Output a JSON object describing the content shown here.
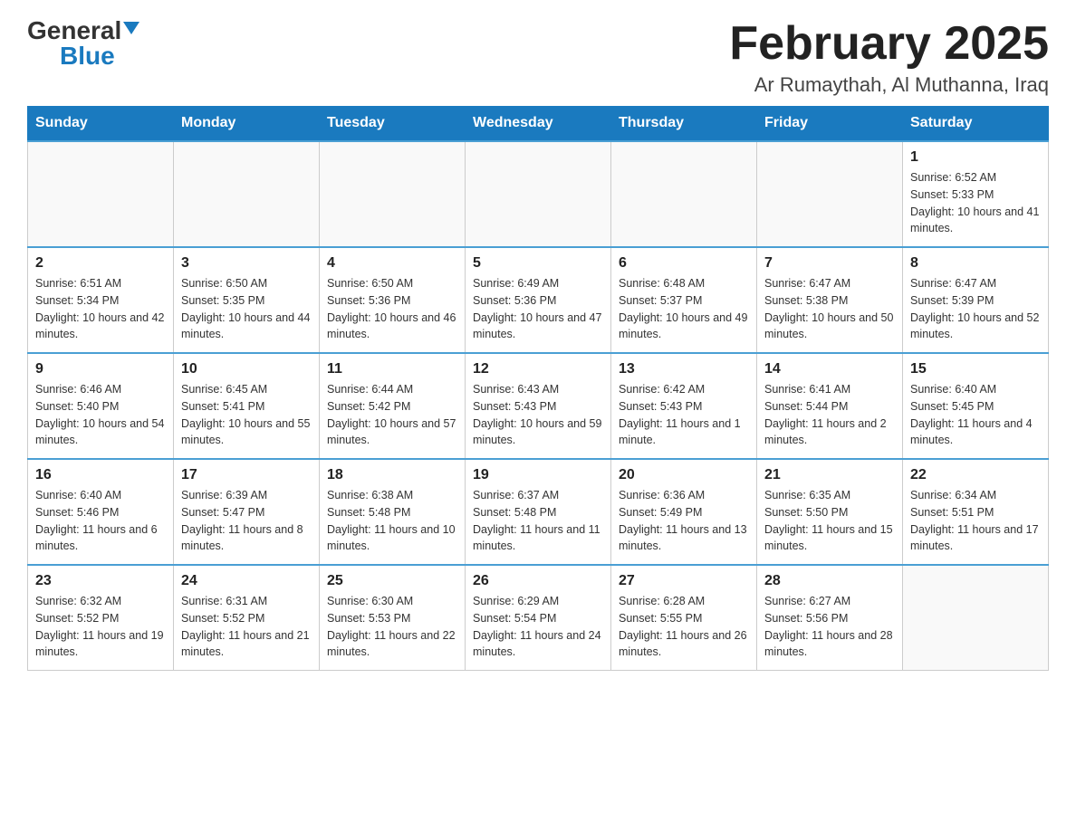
{
  "logo": {
    "general": "General",
    "blue": "Blue",
    "triangle": "▼"
  },
  "title": "February 2025",
  "location": "Ar Rumaythah, Al Muthanna, Iraq",
  "days_of_week": [
    "Sunday",
    "Monday",
    "Tuesday",
    "Wednesday",
    "Thursday",
    "Friday",
    "Saturday"
  ],
  "weeks": [
    [
      {
        "day": "",
        "info": ""
      },
      {
        "day": "",
        "info": ""
      },
      {
        "day": "",
        "info": ""
      },
      {
        "day": "",
        "info": ""
      },
      {
        "day": "",
        "info": ""
      },
      {
        "day": "",
        "info": ""
      },
      {
        "day": "1",
        "info": "Sunrise: 6:52 AM\nSunset: 5:33 PM\nDaylight: 10 hours and 41 minutes."
      }
    ],
    [
      {
        "day": "2",
        "info": "Sunrise: 6:51 AM\nSunset: 5:34 PM\nDaylight: 10 hours and 42 minutes."
      },
      {
        "day": "3",
        "info": "Sunrise: 6:50 AM\nSunset: 5:35 PM\nDaylight: 10 hours and 44 minutes."
      },
      {
        "day": "4",
        "info": "Sunrise: 6:50 AM\nSunset: 5:36 PM\nDaylight: 10 hours and 46 minutes."
      },
      {
        "day": "5",
        "info": "Sunrise: 6:49 AM\nSunset: 5:36 PM\nDaylight: 10 hours and 47 minutes."
      },
      {
        "day": "6",
        "info": "Sunrise: 6:48 AM\nSunset: 5:37 PM\nDaylight: 10 hours and 49 minutes."
      },
      {
        "day": "7",
        "info": "Sunrise: 6:47 AM\nSunset: 5:38 PM\nDaylight: 10 hours and 50 minutes."
      },
      {
        "day": "8",
        "info": "Sunrise: 6:47 AM\nSunset: 5:39 PM\nDaylight: 10 hours and 52 minutes."
      }
    ],
    [
      {
        "day": "9",
        "info": "Sunrise: 6:46 AM\nSunset: 5:40 PM\nDaylight: 10 hours and 54 minutes."
      },
      {
        "day": "10",
        "info": "Sunrise: 6:45 AM\nSunset: 5:41 PM\nDaylight: 10 hours and 55 minutes."
      },
      {
        "day": "11",
        "info": "Sunrise: 6:44 AM\nSunset: 5:42 PM\nDaylight: 10 hours and 57 minutes."
      },
      {
        "day": "12",
        "info": "Sunrise: 6:43 AM\nSunset: 5:43 PM\nDaylight: 10 hours and 59 minutes."
      },
      {
        "day": "13",
        "info": "Sunrise: 6:42 AM\nSunset: 5:43 PM\nDaylight: 11 hours and 1 minute."
      },
      {
        "day": "14",
        "info": "Sunrise: 6:41 AM\nSunset: 5:44 PM\nDaylight: 11 hours and 2 minutes."
      },
      {
        "day": "15",
        "info": "Sunrise: 6:40 AM\nSunset: 5:45 PM\nDaylight: 11 hours and 4 minutes."
      }
    ],
    [
      {
        "day": "16",
        "info": "Sunrise: 6:40 AM\nSunset: 5:46 PM\nDaylight: 11 hours and 6 minutes."
      },
      {
        "day": "17",
        "info": "Sunrise: 6:39 AM\nSunset: 5:47 PM\nDaylight: 11 hours and 8 minutes."
      },
      {
        "day": "18",
        "info": "Sunrise: 6:38 AM\nSunset: 5:48 PM\nDaylight: 11 hours and 10 minutes."
      },
      {
        "day": "19",
        "info": "Sunrise: 6:37 AM\nSunset: 5:48 PM\nDaylight: 11 hours and 11 minutes."
      },
      {
        "day": "20",
        "info": "Sunrise: 6:36 AM\nSunset: 5:49 PM\nDaylight: 11 hours and 13 minutes."
      },
      {
        "day": "21",
        "info": "Sunrise: 6:35 AM\nSunset: 5:50 PM\nDaylight: 11 hours and 15 minutes."
      },
      {
        "day": "22",
        "info": "Sunrise: 6:34 AM\nSunset: 5:51 PM\nDaylight: 11 hours and 17 minutes."
      }
    ],
    [
      {
        "day": "23",
        "info": "Sunrise: 6:32 AM\nSunset: 5:52 PM\nDaylight: 11 hours and 19 minutes."
      },
      {
        "day": "24",
        "info": "Sunrise: 6:31 AM\nSunset: 5:52 PM\nDaylight: 11 hours and 21 minutes."
      },
      {
        "day": "25",
        "info": "Sunrise: 6:30 AM\nSunset: 5:53 PM\nDaylight: 11 hours and 22 minutes."
      },
      {
        "day": "26",
        "info": "Sunrise: 6:29 AM\nSunset: 5:54 PM\nDaylight: 11 hours and 24 minutes."
      },
      {
        "day": "27",
        "info": "Sunrise: 6:28 AM\nSunset: 5:55 PM\nDaylight: 11 hours and 26 minutes."
      },
      {
        "day": "28",
        "info": "Sunrise: 6:27 AM\nSunset: 5:56 PM\nDaylight: 11 hours and 28 minutes."
      },
      {
        "day": "",
        "info": ""
      }
    ]
  ]
}
